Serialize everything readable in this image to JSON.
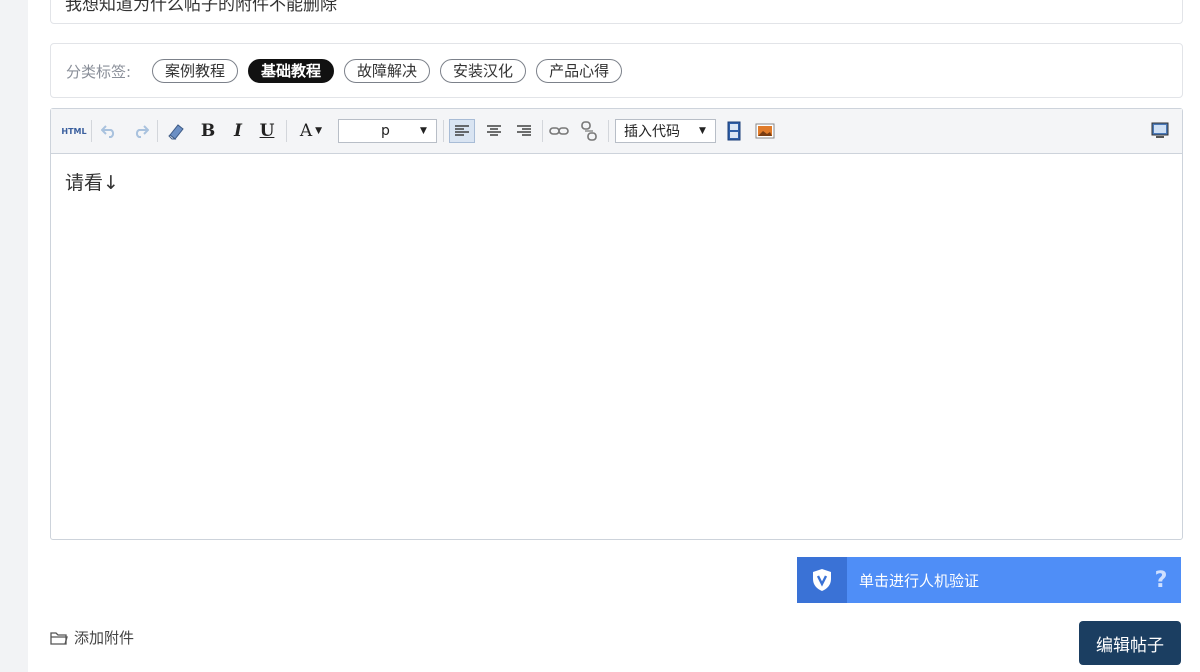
{
  "post": {
    "title_value": "我想知道为什么帖子的附件不能删除"
  },
  "tags": {
    "label": "分类标签:",
    "items": [
      {
        "label": "案例教程",
        "active": false
      },
      {
        "label": "基础教程",
        "active": true
      },
      {
        "label": "故障解决",
        "active": false
      },
      {
        "label": "安装汉化",
        "active": false
      },
      {
        "label": "产品心得",
        "active": false
      }
    ]
  },
  "toolbar": {
    "html_label": "HTML",
    "bold_label": "B",
    "italic_label": "I",
    "underline_label": "U",
    "fontcolor_label": "A",
    "format_value": "p",
    "code_value": "插入代码"
  },
  "editor": {
    "content": "请看↓"
  },
  "captcha": {
    "label": "单击进行人机验证",
    "help": "?"
  },
  "footer": {
    "attach_label": "添加附件",
    "submit_label": "编辑帖子"
  },
  "colors": {
    "accent_blue": "#4f8ef7",
    "submit_navy": "#1b3e61",
    "active_tag": "#111111"
  }
}
